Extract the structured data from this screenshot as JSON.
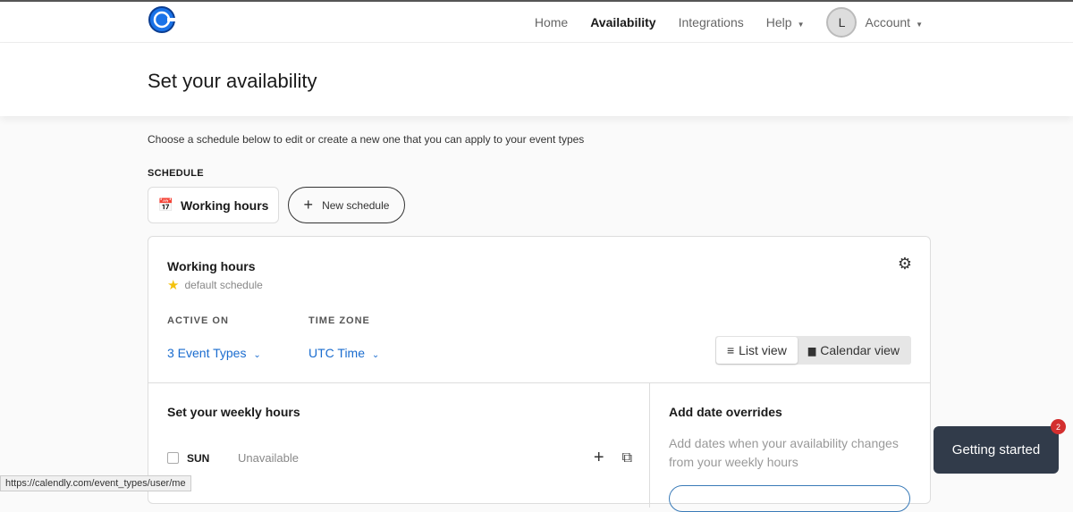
{
  "nav": {
    "home": "Home",
    "availability": "Availability",
    "integrations": "Integrations",
    "help": "Help",
    "avatar": "L",
    "account": "Account"
  },
  "header": {
    "title": "Set your availability"
  },
  "intro": "Choose a schedule below to edit or create a new one that you can apply to your event types",
  "schedule_label": "SCHEDULE",
  "schedule_tab": "Working hours",
  "new_schedule": "New schedule",
  "card": {
    "title": "Working hours",
    "subtitle": "default schedule",
    "active_on_label": "ACTIVE ON",
    "active_on_value": "3 Event Types",
    "timezone_label": "TIME ZONE",
    "timezone_value": "UTC Time",
    "list_view": "List view",
    "calendar_view": "Calendar view"
  },
  "weekly": {
    "title": "Set your weekly hours",
    "rows": [
      {
        "day": "SUN",
        "status": "Unavailable"
      }
    ]
  },
  "overrides": {
    "title": "Add date overrides",
    "desc": "Add dates when your availability changes from your weekly hours"
  },
  "getting_started": {
    "label": "Getting started",
    "badge": "2"
  },
  "status_url": "https://calendly.com/event_types/user/me",
  "colors": {
    "brand": "#006bff",
    "link": "#1a6ccf",
    "toast": "#313b4a"
  }
}
